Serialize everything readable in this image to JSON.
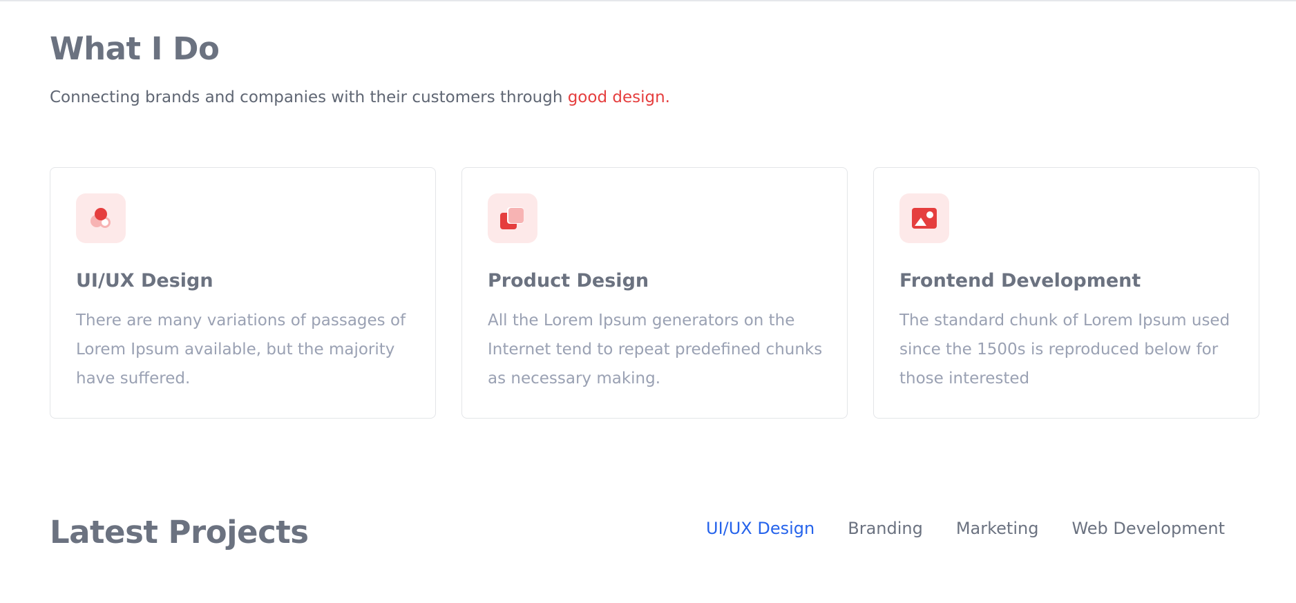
{
  "what_i_do": {
    "title": "What I Do",
    "lead_text": "Connecting brands and companies with their customers through ",
    "lead_accent": "good design."
  },
  "services": [
    {
      "icon": "shapes-icon",
      "title": "UI/UX Design",
      "text": "There are many variations of passages of Lorem Ipsum available, but the majority have suffered."
    },
    {
      "icon": "layers-icon",
      "title": "Product Design",
      "text": "All the Lorem Ipsum generators on the Internet tend to repeat predefined chunks as necessary making."
    },
    {
      "icon": "image-icon",
      "title": "Frontend Development",
      "text": "The standard chunk of Lorem Ipsum used since the 1500s is reproduced below for those interested"
    }
  ],
  "latest_projects": {
    "title": "Latest Projects",
    "filters": [
      "UI/UX Design",
      "Branding",
      "Marketing",
      "Web Development"
    ],
    "active_filter": "UI/UX Design"
  },
  "colors": {
    "accent": "#e53e3e",
    "active_link": "#2563eb",
    "icon_bg": "#fde9e9"
  }
}
